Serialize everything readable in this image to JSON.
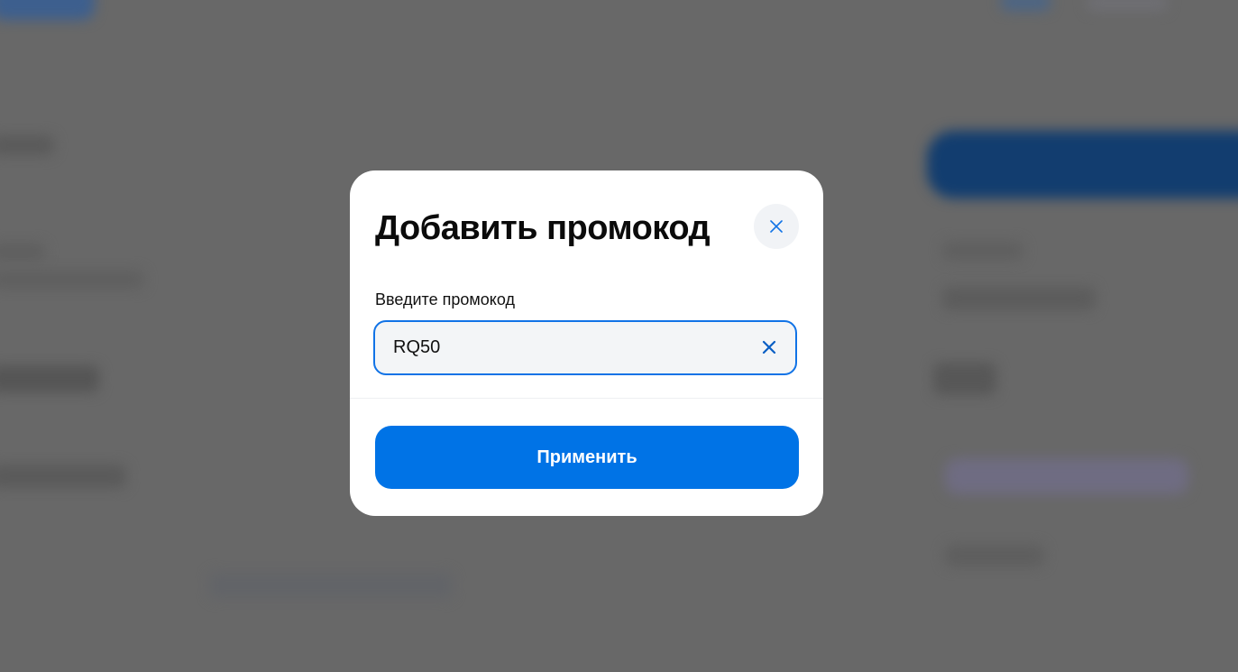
{
  "modal": {
    "title": "Добавить промокод",
    "close_icon": "close-icon",
    "field_label": "Введите промокод",
    "promo_value": "RQ50",
    "clear_icon": "clear-icon",
    "apply_label": "Применить"
  },
  "colors": {
    "accent": "#0073e6",
    "input_border": "#1173e6",
    "overlay": "#686868"
  }
}
